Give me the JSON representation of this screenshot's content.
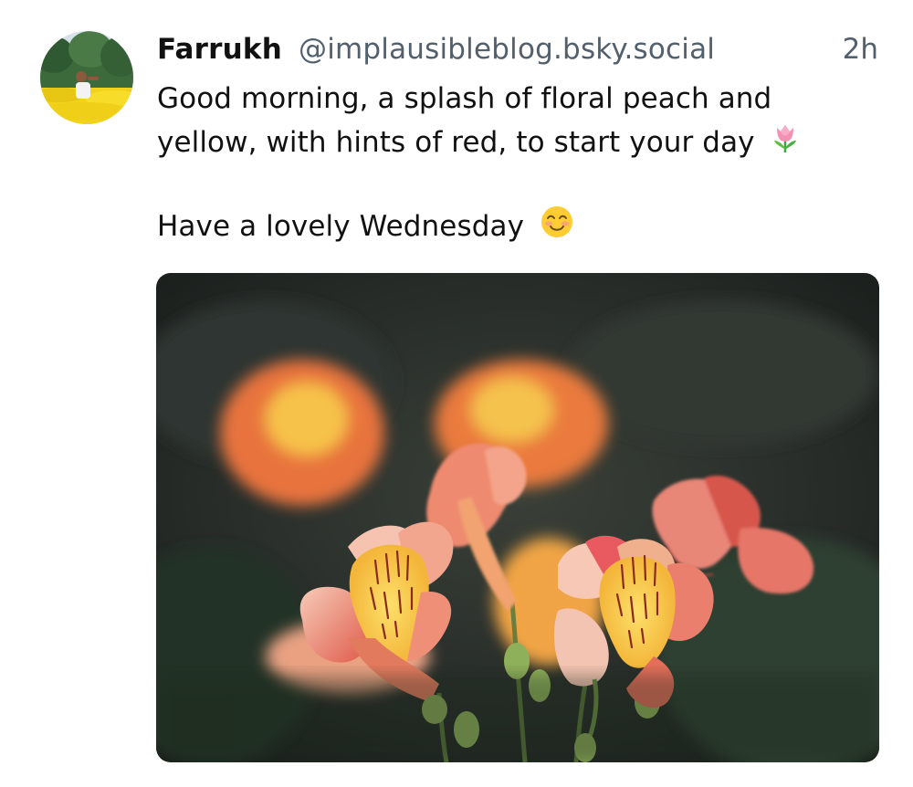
{
  "post": {
    "author": {
      "display_name": "Farrukh",
      "handle": "@implausibleblog.bsky.social",
      "avatar_icon": "avatar-photo"
    },
    "timestamp": "2h",
    "text": {
      "line1": "Good morning, a splash of floral peach and",
      "line2": "yellow, with hints of red, to start your day",
      "line3": "Have a lovely Wednesday",
      "emoji_1": "tulip-emoji",
      "emoji_2": "smiling-face-emoji"
    },
    "image": {
      "subject_icon": "alstroemeria-flowers-photo"
    }
  },
  "colors": {
    "text": "#111111",
    "muted": "#52606d",
    "background": "#ffffff"
  }
}
